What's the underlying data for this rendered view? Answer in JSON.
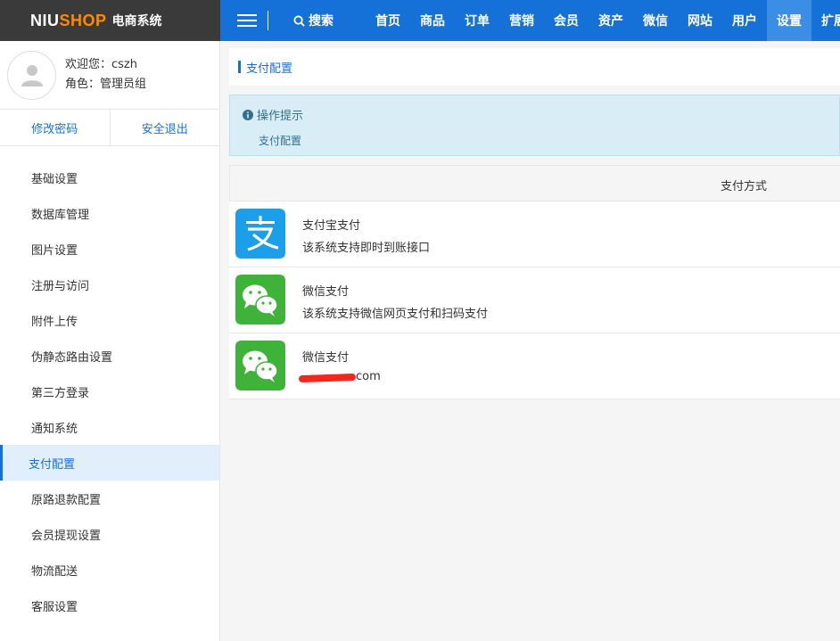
{
  "header": {
    "logo_main": "NIU",
    "logo_accent": "SHOP",
    "logo_sub": "电商系统",
    "search_label": "搜索",
    "nav": [
      {
        "label": "首页",
        "active": false
      },
      {
        "label": "商品",
        "active": false
      },
      {
        "label": "订单",
        "active": false
      },
      {
        "label": "营销",
        "active": false
      },
      {
        "label": "会员",
        "active": false
      },
      {
        "label": "资产",
        "active": false
      },
      {
        "label": "微信",
        "active": false
      },
      {
        "label": "网站",
        "active": false
      },
      {
        "label": "用户",
        "active": false
      },
      {
        "label": "设置",
        "active": true
      },
      {
        "label": "扩展",
        "active": false
      }
    ]
  },
  "user": {
    "welcome": "欢迎您：cszh",
    "role": "角色：管理员组",
    "change_password": "修改密码",
    "logout": "安全退出"
  },
  "sidebar": {
    "items": [
      {
        "label": "基础设置"
      },
      {
        "label": "数据库管理"
      },
      {
        "label": "图片设置"
      },
      {
        "label": "注册与访问"
      },
      {
        "label": "附件上传"
      },
      {
        "label": "伪静态路由设置"
      },
      {
        "label": "第三方登录"
      },
      {
        "label": "通知系统"
      },
      {
        "label": "支付配置"
      },
      {
        "label": "原路退款配置"
      },
      {
        "label": "会员提现设置"
      },
      {
        "label": "物流配送"
      },
      {
        "label": "客服设置"
      }
    ],
    "active_index": 8
  },
  "breadcrumb": {
    "current": "支付配置"
  },
  "tips": {
    "title": "操作提示",
    "description": "支付配置"
  },
  "table": {
    "header": "支付方式",
    "rows": [
      {
        "icon": "alipay-icon",
        "name": "支付宝支付",
        "desc": "该系统支持即时到账接口"
      },
      {
        "icon": "wechat-pay-icon",
        "name": "微信支付",
        "desc": "该系统支持微信网页支付和扫码支付"
      },
      {
        "icon": "wechat-pay-icon",
        "name": "微信支付",
        "desc": "com"
      }
    ]
  },
  "colors": {
    "brand_blue": "#1571d8",
    "logo_orange": "#ff8a00",
    "alipay_blue": "#1a9fe8",
    "wechat_green": "#3fb239",
    "redaction_red": "#f5271c"
  }
}
